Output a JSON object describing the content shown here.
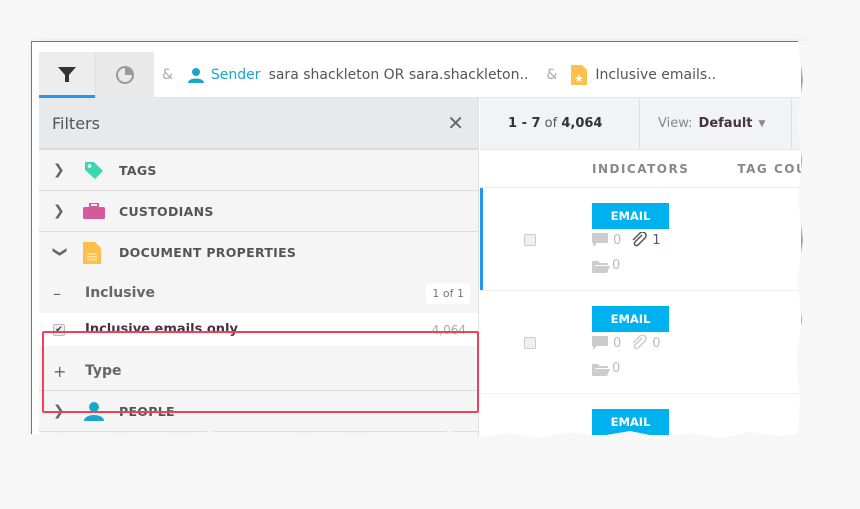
{
  "topbar": {
    "tabs": [
      {
        "name": "filters-tab",
        "icon": "filter-icon",
        "active": true
      },
      {
        "name": "analytics-tab",
        "icon": "pie-chart-icon",
        "active": false
      }
    ],
    "breadcrumbs": {
      "amp1": "&",
      "sender_label": "Sender",
      "sender_value": "sara shackleton OR sara.shackleton..",
      "amp2": "&",
      "doc_value": "Inclusive emails.."
    }
  },
  "filters": {
    "title": "Filters",
    "close_label": "✕",
    "sections": [
      {
        "label": "TAGS",
        "icon": "tag-icon",
        "chevron": "›",
        "color": "#3dd6b4"
      },
      {
        "label": "CUSTODIANS",
        "icon": "briefcase-icon",
        "chevron": "›",
        "color": "#d45a9a"
      },
      {
        "label": "DOCUMENT PROPERTIES",
        "icon": "document-icon",
        "chevron": "⌄",
        "color": "#ffbf4d"
      }
    ],
    "inclusive": {
      "label": "Inclusive",
      "count": "1 of 1",
      "option_label": "Inclusive emails only",
      "option_count": "4,064",
      "checked": true
    },
    "type_label": "Type",
    "people_label": "PEOPLE"
  },
  "results": {
    "range_start": "1",
    "range_sep": " - ",
    "range_end": "7",
    "of_label": " of ",
    "total": "4,064",
    "view_label": "View:",
    "view_value": "Default",
    "columns": [
      "INDICATORS",
      "TAG COU"
    ],
    "rows": [
      {
        "badge": "EMAIL",
        "comments": "0",
        "attachments": "1",
        "folders": "0",
        "selected": true
      },
      {
        "badge": "EMAIL",
        "comments": "0",
        "attachments": "0",
        "folders": "0",
        "selected": false
      },
      {
        "badge": "EMAIL",
        "comments": "",
        "attachments": "",
        "folders": "",
        "selected": false
      }
    ]
  },
  "colors": {
    "accent_blue": "#2196f3",
    "email_badge": "#00b1f0",
    "highlight_red": "#f0415b",
    "sender_teal": "#1aa6c9"
  }
}
